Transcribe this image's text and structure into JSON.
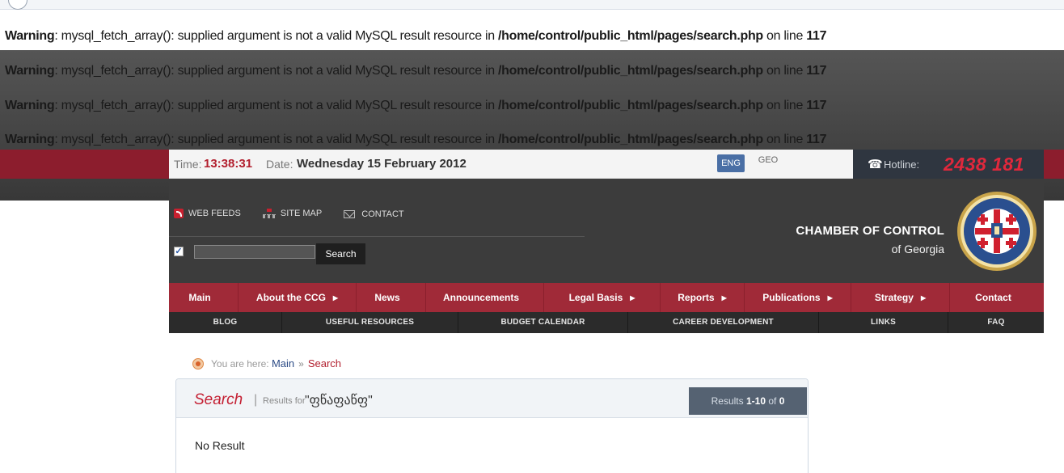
{
  "warnings": [
    {
      "label": "Warning",
      "message": ": mysql_fetch_array(): supplied argument is not a valid MySQL result resource in ",
      "path": "/home/control/public_html/pages/search.php",
      "line_text": " on line ",
      "line": "117"
    },
    {
      "label": "Warning",
      "message": ": mysql_fetch_array(): supplied argument is not a valid MySQL result resource in ",
      "path": "/home/control/public_html/pages/search.php",
      "line_text": " on line ",
      "line": "117"
    },
    {
      "label": "Warning",
      "message": ": mysql_fetch_array(): supplied argument is not a valid MySQL result resource in ",
      "path": "/home/control/public_html/pages/search.php",
      "line_text": " on line ",
      "line": "117"
    },
    {
      "label": "Warning",
      "message": ": mysql_fetch_array(): supplied argument is not a valid MySQL result resource in ",
      "path": "/home/control/public_html/pages/search.php",
      "line_text": " on line ",
      "line": "117"
    }
  ],
  "timebar": {
    "time_label": "Time:",
    "time_value": "13:38:31",
    "date_label": "Date:",
    "date_value": "Wednesday 15 February 2012",
    "lang_active": "ENG",
    "lang_other": "GEO",
    "hotline_label": "Hotline:",
    "hotline_number": "2438 181",
    "phone_glyph": "☎"
  },
  "header": {
    "links": {
      "feeds": "WEB FEEDS",
      "sitemap": "SITE MAP",
      "contact": "CONTACT"
    },
    "checkbox_mark": "✓",
    "search_button": "Search",
    "brand_line1": "CHAMBER OF CONTROL",
    "brand_line2": "of Georgia"
  },
  "nav": [
    {
      "label": "Main",
      "arrow": ""
    },
    {
      "label": "About the CCG",
      "arrow": "▶"
    },
    {
      "label": "News",
      "arrow": ""
    },
    {
      "label": "Announcements",
      "arrow": ""
    },
    {
      "label": "Legal Basis",
      "arrow": "▶"
    },
    {
      "label": "Reports",
      "arrow": "▶"
    },
    {
      "label": "Publications",
      "arrow": "▶"
    },
    {
      "label": "Strategy",
      "arrow": "▶"
    },
    {
      "label": "Contact",
      "arrow": ""
    }
  ],
  "subnav": [
    "BLOG",
    "USEFUL RESOURCES",
    "BUDGET CALENDAR",
    "CAREER DEVELOPMENT",
    "LINKS",
    "FAQ"
  ],
  "breadcrumb": {
    "prefix": "You are here:",
    "main": "Main",
    "separator": "»",
    "current": "Search"
  },
  "results": {
    "title": "Search",
    "pipe": "|",
    "for_label": "Results for",
    "query": "\"ფწაფაწფ\"",
    "count_prefix": "Results ",
    "count_range": "1-10",
    "count_of": " of ",
    "count_total": "0",
    "empty_message": "No Result"
  },
  "colors": {
    "accent_red": "#a02a38",
    "hotline_red": "#e0283c",
    "header_dark": "#3c3c3c",
    "link_blue": "#2d4c86"
  }
}
